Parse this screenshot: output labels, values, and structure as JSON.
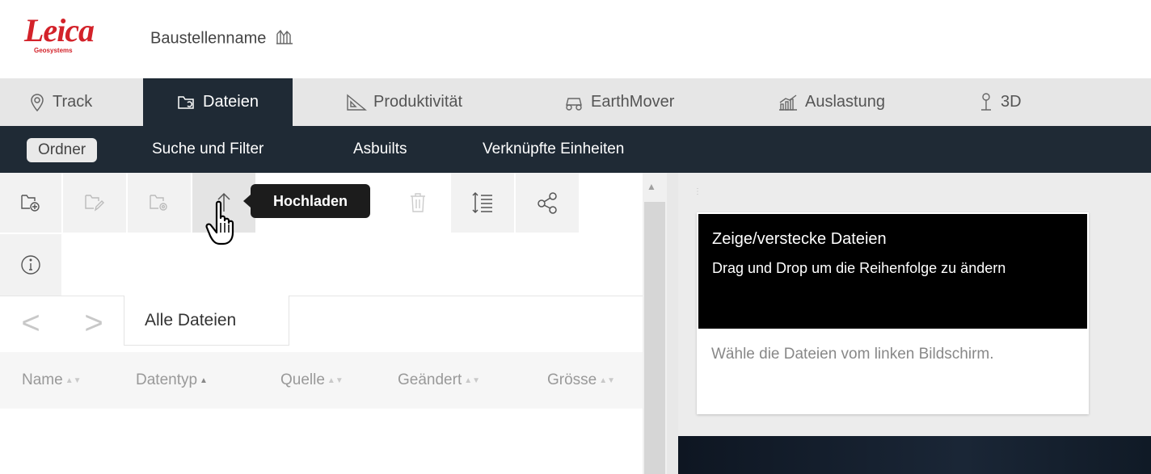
{
  "header": {
    "logo_text": "Leica",
    "logo_sub": "Geosystems",
    "site_name": "Baustellenname"
  },
  "tabs": [
    {
      "label": "Track",
      "icon": "location-pin-icon"
    },
    {
      "label": "Dateien",
      "icon": "folder-sync-icon",
      "active": true
    },
    {
      "label": "Produktivität",
      "icon": "set-square-icon"
    },
    {
      "label": "EarthMover",
      "icon": "vehicle-icon"
    },
    {
      "label": "Auslastung",
      "icon": "chart-bars-icon"
    },
    {
      "label": "3D",
      "icon": "pin-3d-icon"
    }
  ],
  "subnav": [
    {
      "label": "Ordner",
      "active": true
    },
    {
      "label": "Suche und Filter"
    },
    {
      "label": "Asbuilts"
    },
    {
      "label": "Verknüpfte Einheiten"
    }
  ],
  "toolbar": {
    "tooltip": "Hochladen",
    "buttons": [
      "new-folder-icon",
      "rename-folder-icon",
      "folder-settings-icon",
      "upload-icon",
      "delete-icon",
      "sort-lines-icon",
      "share-icon",
      "info-icon"
    ]
  },
  "breadcrumb": {
    "back": "<",
    "forward": ">",
    "current": "Alle Dateien"
  },
  "columns": [
    {
      "label": "Name",
      "sort": "both"
    },
    {
      "label": "Datentyp",
      "sort": "asc"
    },
    {
      "label": "Quelle",
      "sort": "both"
    },
    {
      "label": "Geändert",
      "sort": "both"
    },
    {
      "label": "Grösse",
      "sort": "both"
    }
  ],
  "right_panel": {
    "card_title": "Zeige/verstecke Dateien",
    "card_subtitle": "Drag und Drop um die Reihenfolge zu ändern",
    "card_body": "Wähle die Dateien vom linken Bildschirm."
  },
  "colors": {
    "brand_red": "#d3222a",
    "nav_dark": "#1f2a35",
    "tab_bg": "#e6e6e6"
  }
}
